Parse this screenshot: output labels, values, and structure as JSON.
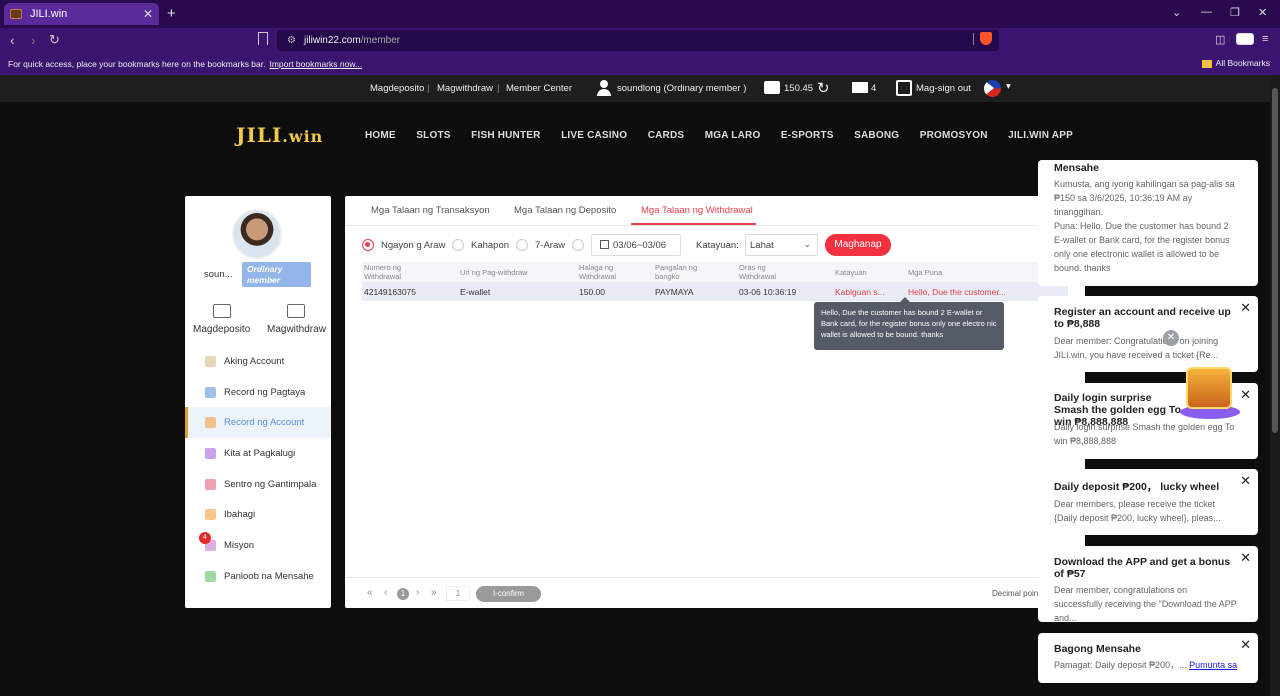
{
  "browser": {
    "tab_title": "JILI.win",
    "tab_close": "✕",
    "new_tab": "+",
    "url_host": "jiliwin22.com",
    "url_path": "/member",
    "bookmarks_hint": "For quick access, place your bookmarks here on the bookmarks bar.",
    "import_link": "Import bookmarks now...",
    "all_bookmarks": "All Bookmarks"
  },
  "topbar": {
    "deposit": "Magdeposito",
    "withdraw": "Magwithdraw",
    "member_center": "Member Center",
    "user": "soundlong (Ordinary member )",
    "balance": "150.45",
    "messages": "4",
    "logout": "Mag-sign out"
  },
  "header": {
    "logo": "JILI",
    "logo_suffix": ".win",
    "nav": [
      "HOME",
      "SLOTS",
      "FISH HUNTER",
      "LIVE CASINO",
      "CARDS",
      "MGA LARO",
      "E-SPORTS",
      "SABONG",
      "PROMOSYON",
      "JILI.WIN APP"
    ]
  },
  "sidebar": {
    "username": "soun...",
    "member_level": "Ordinary member",
    "deposit": "Magdeposito",
    "withdraw": "Magwithdraw",
    "items": [
      {
        "label": "Aking Account",
        "color": "#e8d6b8"
      },
      {
        "label": "Record ng Pagtaya",
        "color": "#9fc0e8"
      },
      {
        "label": "Record ng Account",
        "color": "#f2c08a"
      },
      {
        "label": "Kita at Pagkalugi",
        "color": "#c9a4e8"
      },
      {
        "label": "Sentro ng Gantimpala",
        "color": "#f0a0b0"
      },
      {
        "label": "Ibahagi",
        "color": "#f5c890"
      },
      {
        "label": "Misyon",
        "color": "#d9b0e0"
      },
      {
        "label": "Panloob na Mensahe",
        "color": "#9ed8a0"
      }
    ],
    "misyon_badge": "4"
  },
  "main": {
    "tabs": [
      "Mga Talaan ng Transaksyon",
      "Mga Talaan ng Deposito",
      "Mga Talaan ng Withdrawal"
    ],
    "filters": {
      "today": "Ngayon g Araw",
      "yesterday": "Kahapon",
      "seven_days": "7-Araw",
      "date_range": "03/06~03/06",
      "status_label": "Katayuan:",
      "status_value": "Lahat",
      "search": "Maghanap"
    },
    "columns": [
      "Numero ng Withdrawal",
      "Uri ng Pag-withdraw",
      "Halaga ng Withdrawal",
      "Pangalan ng bangko",
      "Oras ng Withdrawal",
      "Katayuan",
      "Mga Puna"
    ],
    "rows": [
      [
        "42149163075",
        "E-wallet",
        "150.00",
        "PAYMAYA",
        "03-06 10:36:19",
        "Kabiguan s...",
        "Hello, Due the customer..."
      ]
    ],
    "tooltip": "Hello, Due the customer has bound 2 E-wallet or Bank card, for the register bonus only one electro nic wallet is allowed to be bound. thanks",
    "pager": {
      "page": "1",
      "jump": "1",
      "confirm": "I-confirm",
      "decimal": "Decimal poin"
    }
  },
  "notifications": [
    {
      "title": "Mensahe",
      "body": "Kumusta, ang iyong kahilingan sa pag-alis sa ₱150 sa 3/6/2025, 10:36:19 AM ay tinanggihan.\nPuna: Hello, Due the customer has bound 2 E-wallet or Bank card, for the register bonus only one electronic wallet is allowed to be bound. thanks"
    },
    {
      "title": "Register an account and receive up to ₱8,888",
      "body": "Dear member: Congratulations on joining JILI.win, you have received a ticket {Re..."
    },
    {
      "title": "Daily login surprise Smash the golden egg To win ₱8,888,888",
      "body": "Daily login surprise Smash the golden egg To win ₱8,888,888"
    },
    {
      "title": "Daily deposit ₱200， lucky wheel",
      "body": "Dear members, please receive the ticket {Daily deposit ₱200, lucky wheel}, pleas..."
    },
    {
      "title": "Download the APP and get a bonus of ₱57",
      "body": "Dear member, congratulations on successfully receiving the \"Download the APP and..."
    },
    {
      "title": "Bagong Mensahe",
      "body": "Pamagat: Daily deposit ₱200，...",
      "link": "Pumunta sa"
    }
  ]
}
